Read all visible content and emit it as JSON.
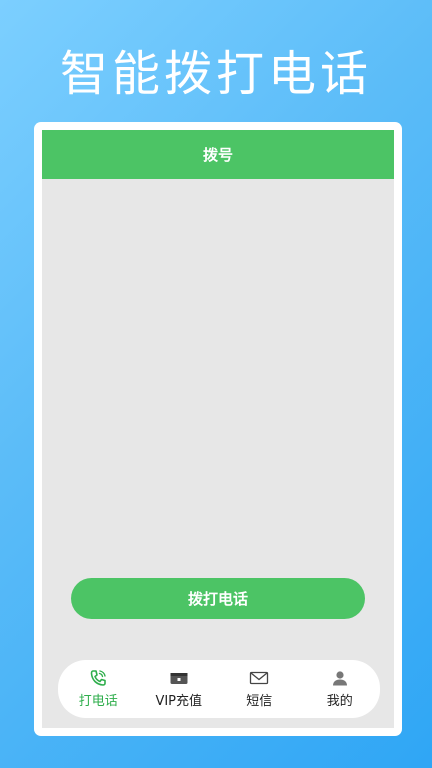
{
  "promo": {
    "title": "智能拨打电话"
  },
  "header": {
    "title": "拨号"
  },
  "main": {
    "call_button_label": "拨打电话"
  },
  "tab_bar": {
    "items": [
      {
        "label": "打电话",
        "icon": "phone-icon",
        "active": true
      },
      {
        "label": "VIP充值",
        "icon": "wallet-icon",
        "active": false
      },
      {
        "label": "短信",
        "icon": "mail-icon",
        "active": false
      },
      {
        "label": "我的",
        "icon": "person-icon",
        "active": false
      }
    ]
  },
  "colors": {
    "accent": "#4cc465",
    "active_tab": "#2fae4c",
    "background_gradient_start": "#7ccfff",
    "background_gradient_end": "#2fa6f5",
    "screen_bg": "#e7e7e7"
  }
}
